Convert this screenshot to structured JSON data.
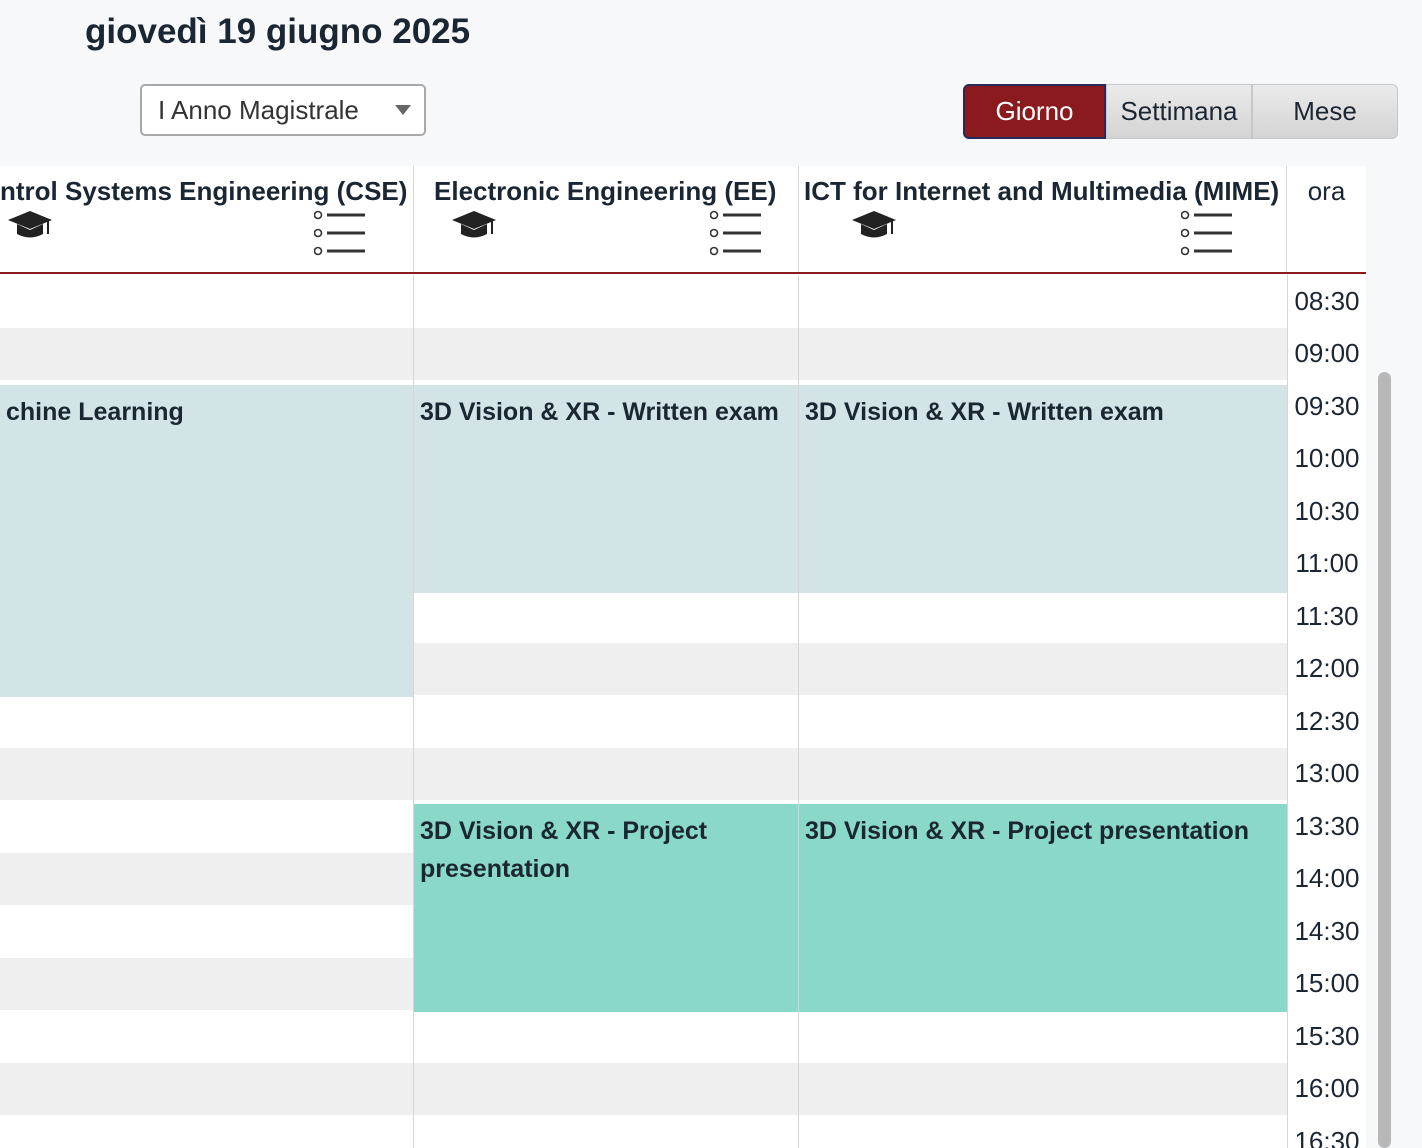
{
  "header": {
    "date_title": "giovedì 19 giugno 2025",
    "year_select": {
      "value": "I Anno Magistrale"
    },
    "views": [
      "Giorno",
      "Settimana",
      "Mese"
    ],
    "active_view": "Giorno"
  },
  "calendar": {
    "columns": [
      {
        "title": "ntrol Systems Engineering (CSE)"
      },
      {
        "title": "Electronic Engineering (EE)"
      },
      {
        "title": "ICT for Internet and Multimedia (MIME)"
      }
    ],
    "time_header": "ora",
    "times": [
      "08:30",
      "09:00",
      "09:30",
      "10:00",
      "10:30",
      "11:00",
      "11:30",
      "12:00",
      "12:30",
      "13:00",
      "13:30",
      "14:00",
      "14:30",
      "15:00",
      "15:30",
      "16:00",
      "16:30"
    ],
    "events": [
      {
        "title": "chine Learning"
      },
      {
        "title": "3D Vision & XR - Written exam"
      },
      {
        "title": "3D Vision & XR - Written exam"
      },
      {
        "title": "3D Vision & XR - Project presentation"
      },
      {
        "title": "3D Vision & XR - Project presentation"
      }
    ]
  },
  "colors": {
    "accent": "#8b1a1f",
    "exam_event": "#d3e4e6",
    "project_event": "#8ad8c7"
  }
}
